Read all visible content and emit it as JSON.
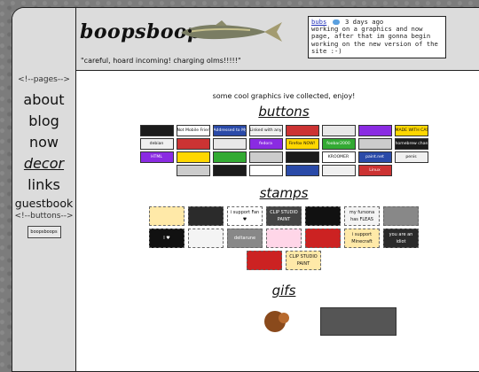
{
  "header": {
    "site_title": "boopsboops",
    "tagline": "\"careful, hoard incoming! charging olms!!!!!\"",
    "status": {
      "user": "bubs",
      "time": "3 days ago",
      "text": "working on a graphics and now page, after that im gonna begin working on the new version of the site :-)"
    }
  },
  "sidebar": {
    "pages_label": "<!--pages-->",
    "items": [
      {
        "label": "about"
      },
      {
        "label": "blog"
      },
      {
        "label": "now"
      },
      {
        "label": "decor"
      },
      {
        "label": "links"
      },
      {
        "label": "guestbook"
      }
    ],
    "buttons_label": "<!--buttons-->",
    "site_button": "boopsboops"
  },
  "main": {
    "intro": "some cool graphics ive collected, enjoy!",
    "sections": {
      "buttons": "buttons",
      "stamps": "stamps",
      "gifs": "gifs"
    },
    "button_rows": [
      [
        "",
        "Not Mobile Friendly",
        "Addressed to My WebScape",
        "Linked with any website",
        "",
        "",
        "",
        "MADE WITH CASCADING STYLE SHEETS"
      ],
      [
        "debian",
        "",
        "",
        "fedora",
        "Firefox NOW!",
        "foobar2000",
        "",
        "homebrew channel"
      ],
      [
        "HTML",
        "",
        "",
        "",
        "",
        "KROOMER",
        "paint.net",
        "penis"
      ],
      [
        "",
        "",
        "",
        "",
        "",
        "Linux"
      ]
    ],
    "stamp_rows": [
      [
        "",
        "",
        "i support Fan ♥",
        "CLIP STUDIO PAINT",
        "",
        "my fursona has FLEAS",
        ""
      ],
      [
        "I ♥",
        "",
        "deltarune",
        "",
        "",
        "i support Minecraft",
        "you are an idiot"
      ],
      [
        "",
        "CLIP STUDIO PAINT"
      ]
    ]
  },
  "colors": {
    "page_bg": "#7c7c7c",
    "panel_bg": "#dcdcdc",
    "content_bg": "#ffffff",
    "link_blue": "#2233bb"
  },
  "icons": [
    "fish-icon",
    "bird-icon"
  ]
}
